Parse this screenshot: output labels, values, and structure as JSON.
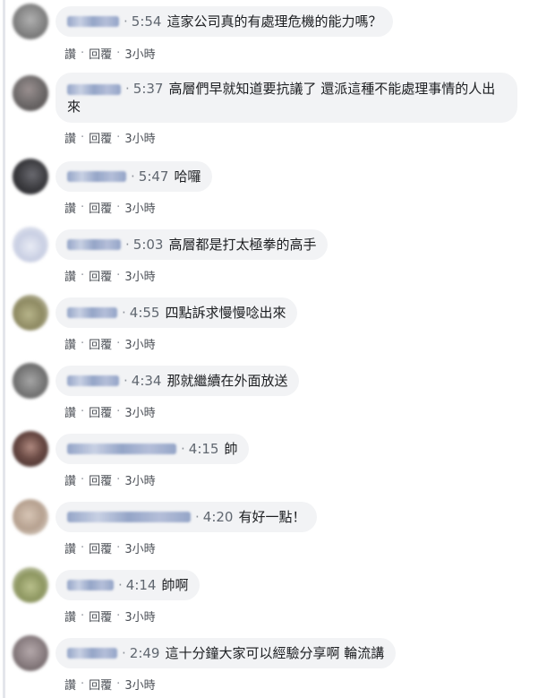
{
  "actions": {
    "like": "讚",
    "reply": "回覆",
    "age": "3小時"
  },
  "comments": [
    {
      "time": "5:54",
      "text": "這家公司真的有處理危機的能力嗎？",
      "avatar_color": "#8a8a8a"
    },
    {
      "time": "5:37",
      "text": "高層們早就知道要抗議了 還派這種不能處理事情的人出來",
      "avatar_color": "#6e6a6a"
    },
    {
      "time": "5:47",
      "text": "哈囉",
      "avatar_color": "#3c3c40"
    },
    {
      "time": "5:03",
      "text": "高層都是打太極拳的高手",
      "avatar_color": "#c9cfe3"
    },
    {
      "time": "4:55",
      "text": "四點訴求慢慢唸出來",
      "avatar_color": "#8e8a62"
    },
    {
      "time": "4:34",
      "text": "那就繼續在外面放送",
      "avatar_color": "#7a7a7a"
    },
    {
      "time": "4:15",
      "text": "帥",
      "avatar_color": "#6b4b45"
    },
    {
      "time": "4:20",
      "text": "有好一點！",
      "avatar_color": "#b6a190"
    },
    {
      "time": "4:14",
      "text": "帥啊",
      "avatar_color": "#8d9660"
    },
    {
      "time": "2:49",
      "text": "這十分鐘大家可以經驗分享啊 輪流講",
      "avatar_color": "#8b7f82"
    }
  ]
}
